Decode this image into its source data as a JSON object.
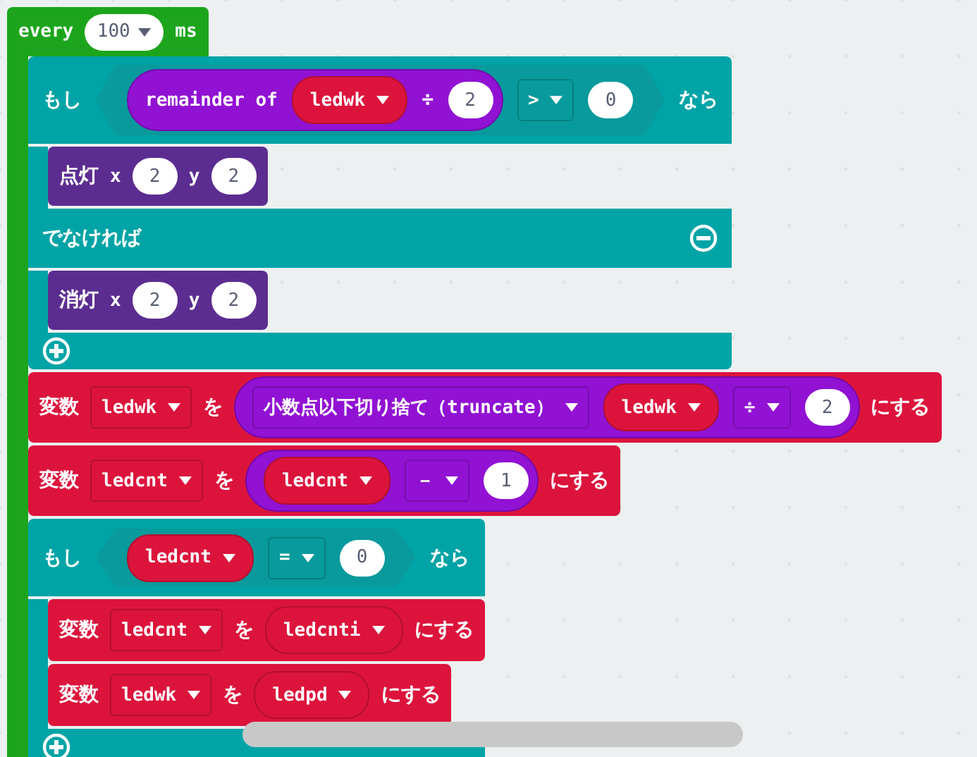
{
  "event": {
    "kind": "every",
    "label": "every",
    "value": "100",
    "unit": "ms"
  },
  "body": [
    {
      "kind": "if",
      "rows": [
        {
          "kind": "header",
          "parts": [
            {
              "kind": "label",
              "text": "もし"
            },
            {
              "kind": "compare",
              "parts": [
                {
                  "kind": "math",
                  "parts": [
                    {
                      "kind": "label",
                      "text": "remainder of"
                    },
                    {
                      "kind": "var",
                      "text": "ledwk"
                    },
                    {
                      "kind": "label",
                      "text": "÷"
                    },
                    {
                      "kind": "num",
                      "text": "2"
                    }
                  ]
                },
                {
                  "kind": "op",
                  "text": ">"
                },
                {
                  "kind": "num",
                  "text": "0"
                }
              ]
            },
            {
              "kind": "label",
              "text": "なら"
            }
          ]
        },
        {
          "kind": "body",
          "blocks": [
            {
              "kind": "led",
              "parts": [
                {
                  "kind": "label",
                  "text": "点灯"
                },
                {
                  "kind": "label",
                  "text": "x"
                },
                {
                  "kind": "num",
                  "text": "2"
                },
                {
                  "kind": "label",
                  "text": "y"
                },
                {
                  "kind": "num",
                  "text": "2"
                }
              ]
            }
          ]
        },
        {
          "kind": "else",
          "text": "でなければ"
        },
        {
          "kind": "body",
          "blocks": [
            {
              "kind": "led",
              "parts": [
                {
                  "kind": "label",
                  "text": "消灯"
                },
                {
                  "kind": "label",
                  "text": "x"
                },
                {
                  "kind": "num",
                  "text": "2"
                },
                {
                  "kind": "label",
                  "text": "y"
                },
                {
                  "kind": "num",
                  "text": "2"
                }
              ]
            }
          ]
        },
        {
          "kind": "footer"
        }
      ]
    },
    {
      "kind": "set",
      "parts": [
        {
          "kind": "label",
          "text": "変数"
        },
        {
          "kind": "field",
          "text": "ledwk"
        },
        {
          "kind": "label",
          "text": "を"
        },
        {
          "kind": "math",
          "parts": [
            {
              "kind": "op",
              "text": "小数点以下切り捨て（truncate）"
            },
            {
              "kind": "var",
              "text": "ledwk"
            },
            {
              "kind": "op",
              "text": "÷"
            },
            {
              "kind": "num",
              "text": "2"
            }
          ]
        },
        {
          "kind": "label",
          "text": "にする"
        }
      ]
    },
    {
      "kind": "set",
      "parts": [
        {
          "kind": "label",
          "text": "変数"
        },
        {
          "kind": "field",
          "text": "ledcnt"
        },
        {
          "kind": "label",
          "text": "を"
        },
        {
          "kind": "math",
          "parts": [
            {
              "kind": "var",
              "text": "ledcnt"
            },
            {
              "kind": "op",
              "text": "－"
            },
            {
              "kind": "num",
              "text": "1"
            }
          ]
        },
        {
          "kind": "label",
          "text": "にする"
        }
      ]
    },
    {
      "kind": "if",
      "rows": [
        {
          "kind": "header",
          "parts": [
            {
              "kind": "label",
              "text": "もし"
            },
            {
              "kind": "compare",
              "parts": [
                {
                  "kind": "var",
                  "text": "ledcnt"
                },
                {
                  "kind": "op",
                  "text": "="
                },
                {
                  "kind": "num",
                  "text": "0"
                }
              ]
            },
            {
              "kind": "label",
              "text": "なら"
            }
          ]
        },
        {
          "kind": "body",
          "blocks": [
            {
              "kind": "set",
              "parts": [
                {
                  "kind": "label",
                  "text": "変数"
                },
                {
                  "kind": "field",
                  "text": "ledcnt"
                },
                {
                  "kind": "label",
                  "text": "を"
                },
                {
                  "kind": "var",
                  "text": "ledcnti"
                },
                {
                  "kind": "label",
                  "text": "にする"
                }
              ]
            },
            {
              "kind": "set",
              "parts": [
                {
                  "kind": "label",
                  "text": "変数"
                },
                {
                  "kind": "field",
                  "text": "ledwk"
                },
                {
                  "kind": "label",
                  "text": "を"
                },
                {
                  "kind": "var",
                  "text": "ledpd"
                },
                {
                  "kind": "label",
                  "text": "にする"
                }
              ]
            }
          ]
        },
        {
          "kind": "footer"
        }
      ]
    }
  ]
}
